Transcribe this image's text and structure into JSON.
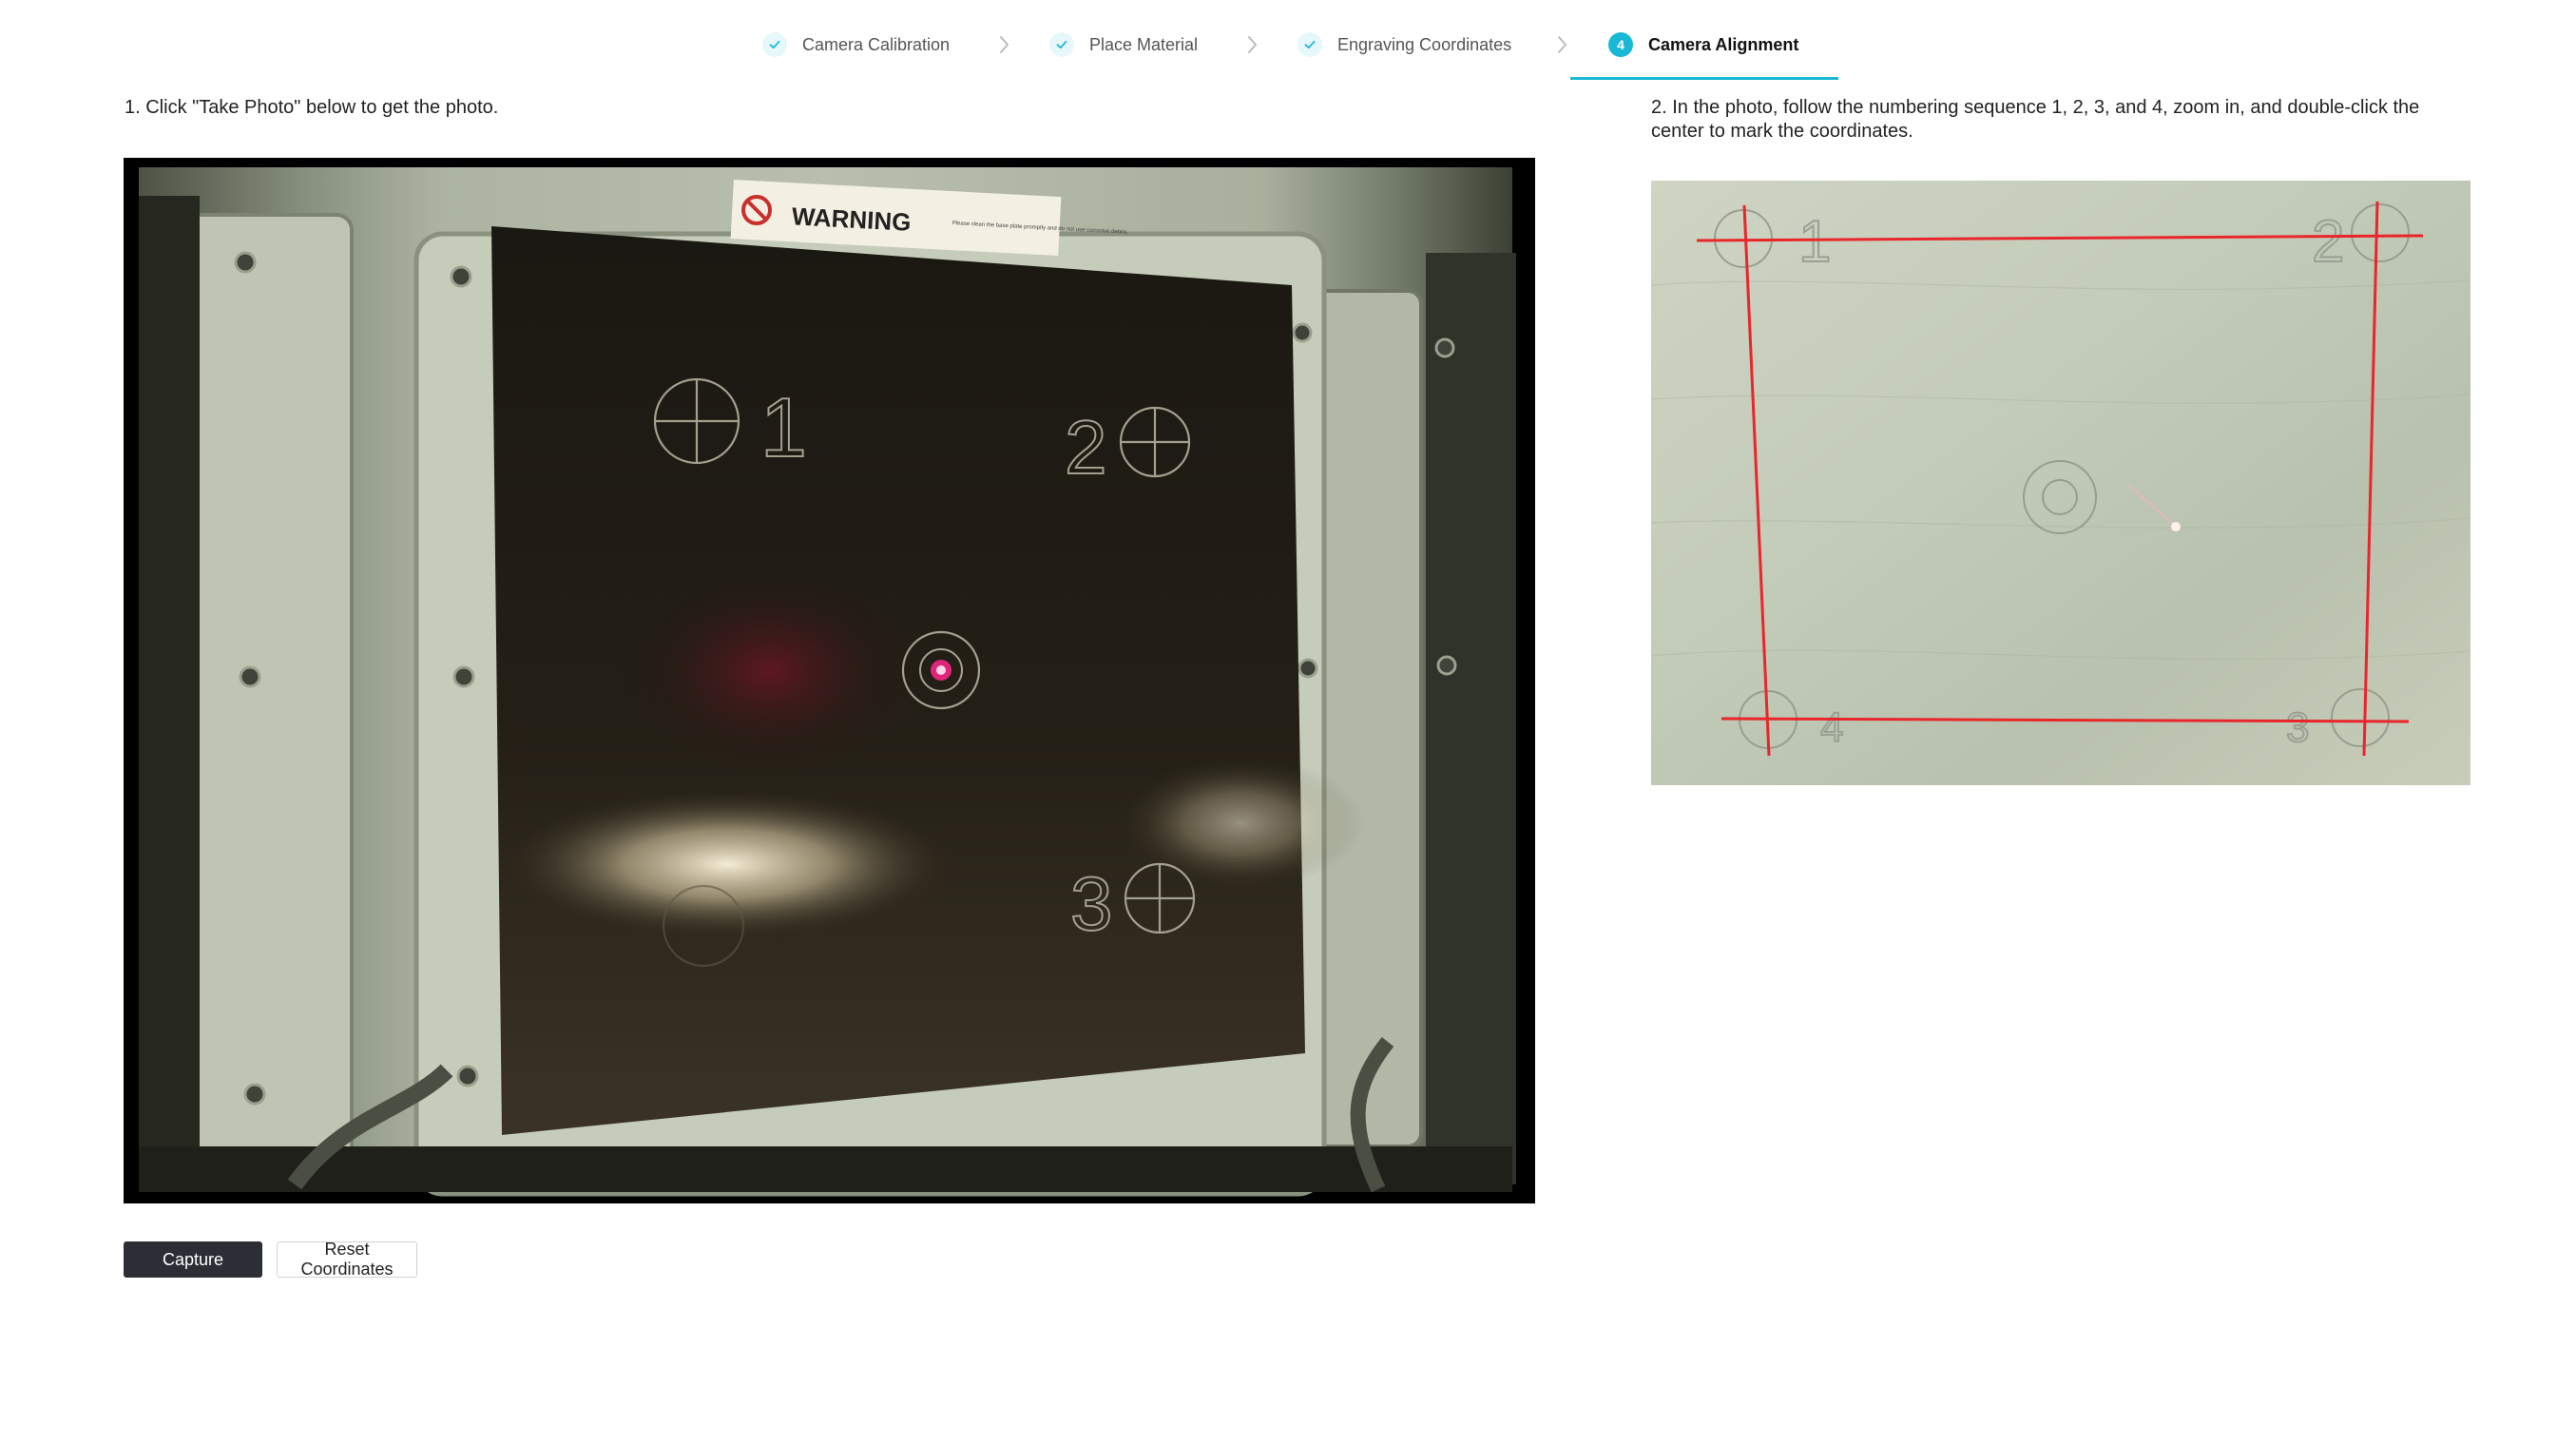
{
  "stepper": {
    "steps": [
      {
        "label": "Camera Calibration",
        "status": "done"
      },
      {
        "label": "Place Material",
        "status": "done"
      },
      {
        "label": "Engraving Coordinates",
        "status": "done"
      },
      {
        "label": "Camera Alignment",
        "status": "current",
        "number": "4"
      }
    ],
    "icons": {
      "done": "check-icon",
      "separator": "chevron-right-icon"
    }
  },
  "left_panel": {
    "instruction": "1. Click \"Take Photo\" below to get the photo.",
    "photo": {
      "warning_text": "WARNING",
      "warning_fine_print": "Please clean the base plate promptly and do not use corrosive debris.",
      "marker_labels": [
        "1",
        "2",
        "3"
      ]
    },
    "buttons": {
      "capture": "Capture",
      "reset": "Reset Coordinates"
    }
  },
  "right_panel": {
    "instruction": "2. In the photo, follow the numbering sequence 1, 2, 3, and 4, zoom in, and double-click the center to mark the coordinates.",
    "photo": {
      "corner_labels": [
        "1",
        "2",
        "3",
        "4"
      ]
    }
  },
  "colors": {
    "accent": "#19b8d6",
    "primary_button": "#2b2f35",
    "laser_line": "#e8262b"
  }
}
